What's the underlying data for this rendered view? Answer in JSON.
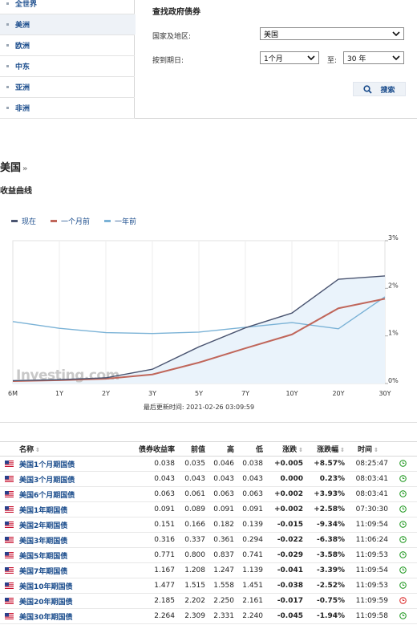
{
  "sidebar": {
    "items": [
      {
        "label": "全世界",
        "active": false
      },
      {
        "label": "美洲",
        "active": true
      },
      {
        "label": "欧洲",
        "active": false
      },
      {
        "label": "中东",
        "active": false
      },
      {
        "label": "亚洲",
        "active": false
      },
      {
        "label": "非洲",
        "active": false
      }
    ]
  },
  "finder": {
    "title": "查找政府债券",
    "country_label": "国家及地区:",
    "country_value": "美国",
    "maturity_label": "按到期日:",
    "maturity_from": "1个月",
    "to_label": "至:",
    "maturity_to": "30 年",
    "search_label": "搜索"
  },
  "country": {
    "name": "美国",
    "raquo": "»"
  },
  "yield_curve_title": "收益曲线",
  "legend": [
    {
      "label": "现在",
      "color": "#4a5470"
    },
    {
      "label": "一个月前",
      "color": "#c0665a"
    },
    {
      "label": "一年前",
      "color": "#7ab2d6"
    }
  ],
  "watermark": "Investing.com",
  "chart_data": {
    "type": "line",
    "x": [
      "6M",
      "1Y",
      "2Y",
      "3Y",
      "5Y",
      "7Y",
      "10Y",
      "20Y",
      "30Y"
    ],
    "y_ticks": [
      "0%",
      "1%",
      "2%",
      "3%"
    ],
    "ylim": [
      0,
      3
    ],
    "series": [
      {
        "name": "现在",
        "color": "#4a5470",
        "values": [
          0.06,
          0.08,
          0.12,
          0.3,
          0.77,
          1.17,
          1.48,
          2.19,
          2.26
        ]
      },
      {
        "name": "一个月前",
        "color": "#c0665a",
        "values": [
          0.05,
          0.07,
          0.1,
          0.19,
          0.44,
          0.74,
          1.03,
          1.58,
          1.78
        ]
      },
      {
        "name": "一年前",
        "color": "#7ab2d6",
        "values": [
          1.3,
          1.16,
          1.07,
          1.05,
          1.08,
          1.18,
          1.28,
          1.15,
          1.82
        ]
      }
    ]
  },
  "updated_text": "最后更新时间: 2021-02-26 03:09:59",
  "table": {
    "headers": [
      "名称",
      "债券收益率",
      "前值",
      "高",
      "低",
      "涨跌",
      "涨跌幅",
      "时间"
    ],
    "sort_glyph": "⇕",
    "rows": [
      {
        "name": "美国1个月期国债",
        "yield": "0.038",
        "prev": "0.035",
        "high": "0.046",
        "low": "0.038",
        "chg": "+0.005",
        "chg_pct": "+8.57%",
        "time": "08:25:47",
        "dir": "pos",
        "clock": "green"
      },
      {
        "name": "美国3个月期国债",
        "yield": "0.043",
        "prev": "0.043",
        "high": "0.043",
        "low": "0.043",
        "chg": "0.000",
        "chg_pct": "0.23%",
        "time": "08:03:41",
        "dir": "zero",
        "clock": "green"
      },
      {
        "name": "美国6个月期国债",
        "yield": "0.063",
        "prev": "0.061",
        "high": "0.063",
        "low": "0.063",
        "chg": "+0.002",
        "chg_pct": "+3.93%",
        "time": "08:03:41",
        "dir": "pos",
        "clock": "green"
      },
      {
        "name": "美国1年期国债",
        "yield": "0.091",
        "prev": "0.089",
        "high": "0.091",
        "low": "0.091",
        "chg": "+0.002",
        "chg_pct": "+2.58%",
        "time": "07:30:30",
        "dir": "pos",
        "clock": "green"
      },
      {
        "name": "美国2年期国债",
        "yield": "0.151",
        "prev": "0.166",
        "high": "0.182",
        "low": "0.139",
        "chg": "-0.015",
        "chg_pct": "-9.34%",
        "time": "11:09:54",
        "dir": "neg",
        "clock": "green"
      },
      {
        "name": "美国3年期国债",
        "yield": "0.316",
        "prev": "0.337",
        "high": "0.361",
        "low": "0.294",
        "chg": "-0.022",
        "chg_pct": "-6.38%",
        "time": "11:06:24",
        "dir": "neg",
        "clock": "green"
      },
      {
        "name": "美国5年期国债",
        "yield": "0.771",
        "prev": "0.800",
        "high": "0.837",
        "low": "0.741",
        "chg": "-0.029",
        "chg_pct": "-3.58%",
        "time": "11:09:53",
        "dir": "neg",
        "clock": "green"
      },
      {
        "name": "美国7年期国债",
        "yield": "1.167",
        "prev": "1.208",
        "high": "1.247",
        "low": "1.139",
        "chg": "-0.041",
        "chg_pct": "-3.39%",
        "time": "11:09:54",
        "dir": "neg",
        "clock": "green"
      },
      {
        "name": "美国10年期国债",
        "yield": "1.477",
        "prev": "1.515",
        "high": "1.558",
        "low": "1.451",
        "chg": "-0.038",
        "chg_pct": "-2.52%",
        "time": "11:09:53",
        "dir": "neg",
        "clock": "green"
      },
      {
        "name": "美国20年期国债",
        "yield": "2.185",
        "prev": "2.202",
        "high": "2.250",
        "low": "2.161",
        "chg": "-0.017",
        "chg_pct": "-0.75%",
        "time": "11:09:59",
        "dir": "neg",
        "clock": "red"
      },
      {
        "name": "美国30年期国债",
        "yield": "2.264",
        "prev": "2.309",
        "high": "2.331",
        "low": "2.240",
        "chg": "-0.045",
        "chg_pct": "-1.94%",
        "time": "11:09:58",
        "dir": "neg",
        "clock": "green"
      }
    ]
  }
}
